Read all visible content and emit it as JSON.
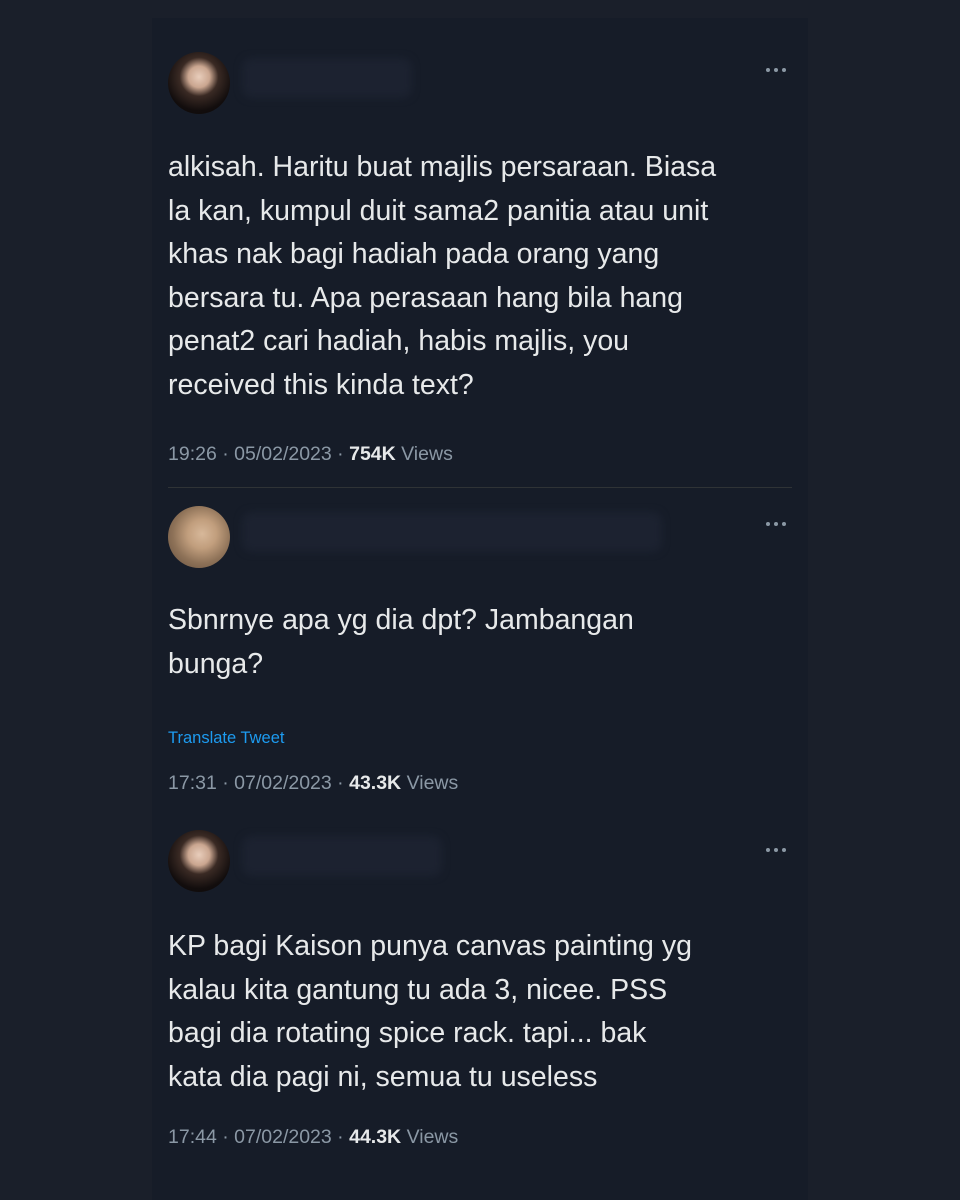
{
  "tweets": [
    {
      "text": "alkisah. Haritu buat majlis persaraan. Biasa\nla kan, kumpul duit sama2 panitia atau unit\nkhas nak bagi hadiah pada orang yang\nbersara tu. Apa perasaan hang bila hang\npenat2 cari hadiah, habis majlis, you\nreceived this kinda text?",
      "time": "19:26",
      "date": "05/02/2023",
      "views_count": "754K",
      "views_label": "Views"
    },
    {
      "text": "Sbnrnye apa yg dia dpt? Jambangan\nbunga?",
      "translate_label": "Translate Tweet",
      "time": "17:31",
      "date": "07/02/2023",
      "views_count": "43.3K",
      "views_label": "Views"
    },
    {
      "text": "KP bagi Kaison punya canvas painting yg\nkalau kita gantung tu ada 3, nicee. PSS\nbagi dia rotating spice rack. tapi... bak\nkata dia pagi ni, semua tu useless",
      "time": "17:44",
      "date": "07/02/2023",
      "views_count": "44.3K",
      "views_label": "Views"
    }
  ],
  "icons": {
    "more": "more-options-icon",
    "avatar": "avatar"
  },
  "colors": {
    "background": "#1a1f2a",
    "panel": "#161c28",
    "text": "#e7e9ea",
    "muted": "#8b98a5",
    "link": "#1d9bf0"
  }
}
